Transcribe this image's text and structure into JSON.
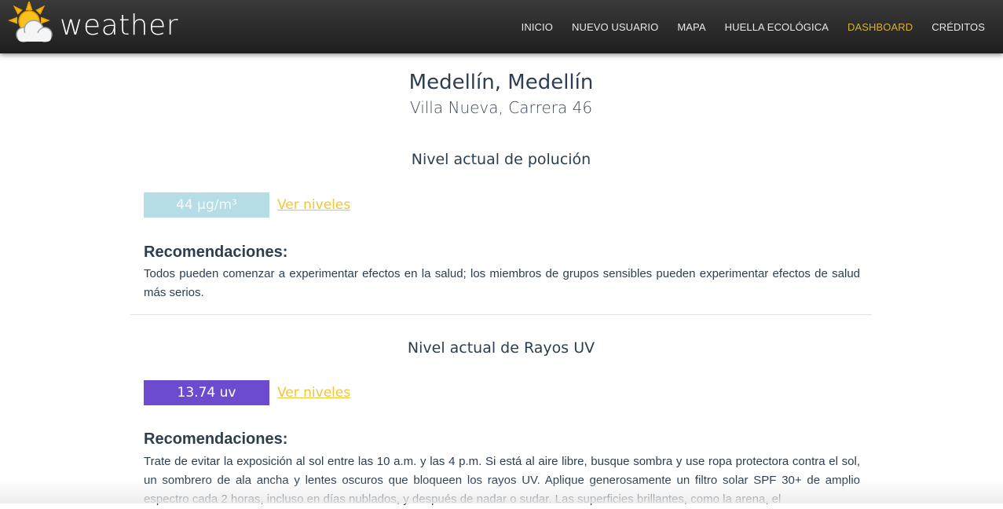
{
  "brand": {
    "name": "weather",
    "logo_icon": "sun-cloud-icon"
  },
  "nav": {
    "items": [
      "INICIO",
      "NUEVO USUARIO",
      "MAPA",
      "HUELLA ECOLÓGICA",
      "DASHBOARD",
      "CRÉDITOS"
    ],
    "active": "DASHBOARD",
    "active_color": "#d4b03a"
  },
  "location": {
    "city": "Medellín, Medellín",
    "address": "Villa Nueva, Carrera 46"
  },
  "pollution": {
    "title": "Nivel actual de polución",
    "value": "44 µg/m³",
    "badge_color": "#b6dde6",
    "link_label": "Ver niveles",
    "rec_title": "Recomendaciones:",
    "rec_text": "Todos pueden comenzar a experimentar efectos en la salud; los miembros de grupos sensibles pueden experimentar efectos de salud más serios."
  },
  "uv": {
    "title": "Nivel actual de Rayos UV",
    "value": "13.74 uv",
    "badge_color": "#6b4ccf",
    "link_label": "Ver niveles",
    "rec_title": "Recomendaciones:",
    "rec_text": "Trate de evitar la exposición al sol entre las 10 a.m. y las 4 p.m. Si está al aire libre, busque sombra y use ropa protectora contra el sol, un sombrero de ala ancha y lentes oscuros que bloqueen los rayos UV. Aplique generosamente un filtro solar SPF 30+ de amplio espectro cada 2 horas, incluso en días nublados, y después de nadar o sudar. Las superficies brillantes, como la arena, el"
  },
  "link_color": "#f2c533"
}
